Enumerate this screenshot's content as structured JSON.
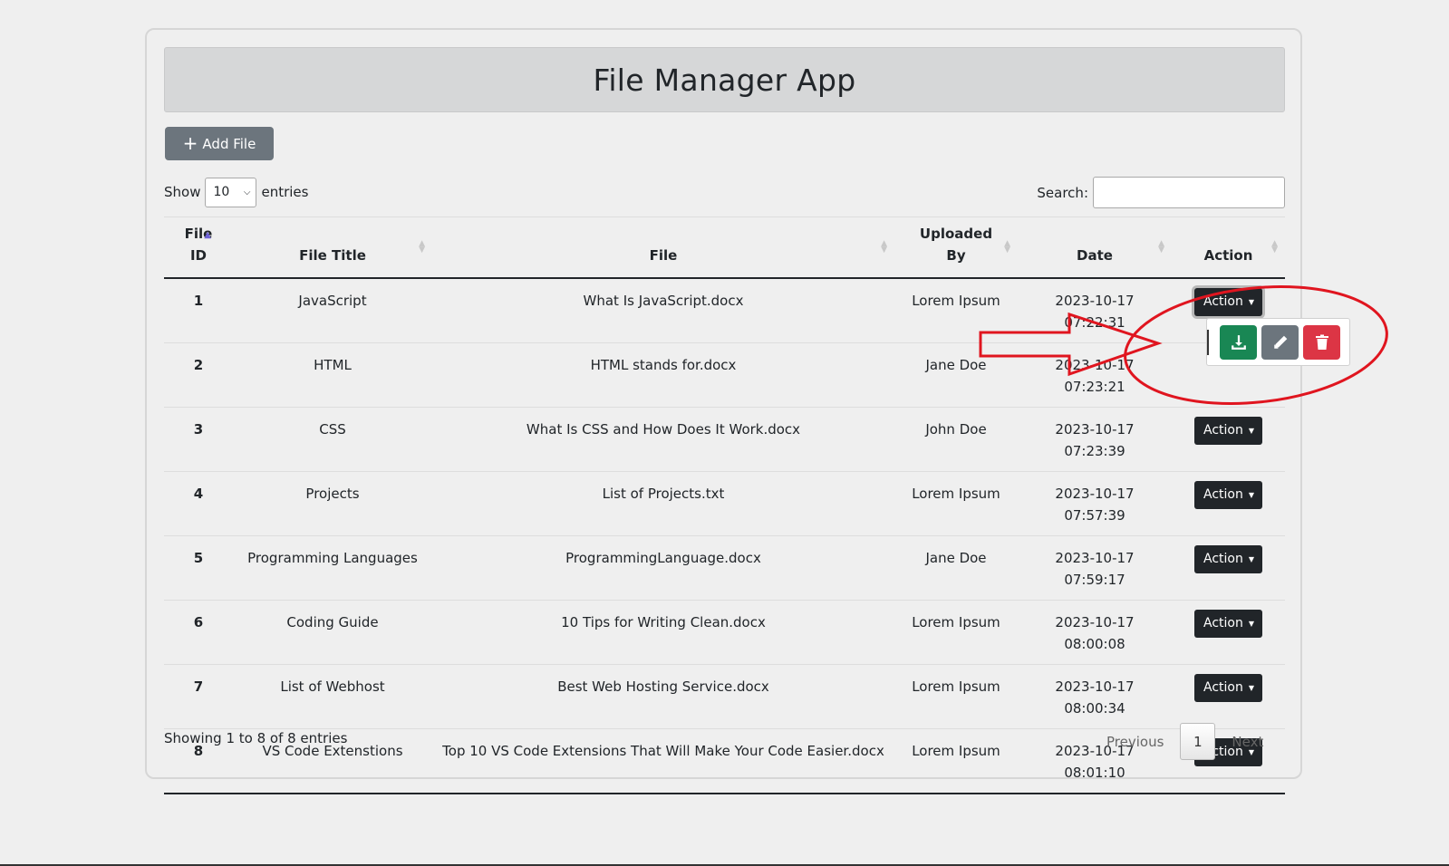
{
  "app": {
    "title": "File Manager App"
  },
  "toolbar": {
    "add_label": "Add File"
  },
  "length_menu": {
    "show": "Show",
    "value": "10",
    "entries": "entries"
  },
  "search": {
    "label": "Search:",
    "value": ""
  },
  "table": {
    "headers": {
      "id_line1": "File",
      "id_line2": "ID",
      "title": "File Title",
      "file": "File",
      "uploaded_line1": "Uploaded",
      "uploaded_line2": "By",
      "date": "Date",
      "action": "Action"
    },
    "sorted_column": "File ID",
    "sort_direction": "ascending",
    "rows": [
      {
        "id": "1",
        "title": "JavaScript",
        "file": "What Is JavaScript.docx",
        "by": "Lorem Ipsum",
        "date": "2023-10-17 07:22:31",
        "action": "Action"
      },
      {
        "id": "2",
        "title": "HTML",
        "file": "HTML stands for.docx",
        "by": "Jane Doe",
        "date": "2023-10-17 07:23:21",
        "action": ""
      },
      {
        "id": "3",
        "title": "CSS",
        "file": "What Is CSS and How Does It Work.docx",
        "by": "John Doe",
        "date": "2023-10-17 07:23:39",
        "action": "Action"
      },
      {
        "id": "4",
        "title": "Projects",
        "file": "List of Projects.txt",
        "by": "Lorem Ipsum",
        "date": "2023-10-17 07:57:39",
        "action": "Action"
      },
      {
        "id": "5",
        "title": "Programming Languages",
        "file": "ProgrammingLanguage.docx",
        "by": "Jane Doe",
        "date": "2023-10-17 07:59:17",
        "action": "Action"
      },
      {
        "id": "6",
        "title": "Coding Guide",
        "file": "10 Tips for Writing Clean.docx",
        "by": "Lorem Ipsum",
        "date": "2023-10-17 08:00:08",
        "action": "Action"
      },
      {
        "id": "7",
        "title": "List of Webhost",
        "file": "Best Web Hosting Service.docx",
        "by": "Lorem Ipsum",
        "date": "2023-10-17 08:00:34",
        "action": "Action"
      },
      {
        "id": "8",
        "title": "VS Code Extenstions",
        "file": "Top 10 VS Code Extensions That Will Make Your Code Easier.docx",
        "by": "Lorem Ipsum",
        "date": "2023-10-17 08:01:10",
        "action": "Action"
      }
    ]
  },
  "dropdown": {
    "open_for_row": "1",
    "items": [
      {
        "icon": "download-icon",
        "color": "#198754"
      },
      {
        "icon": "pencil-icon",
        "color": "#6c757d"
      },
      {
        "icon": "trash-icon",
        "color": "#dc3545"
      }
    ]
  },
  "footer": {
    "info": "Showing 1 to 8 of 8 entries",
    "previous": "Previous",
    "current_page": "1",
    "next": "Next"
  },
  "annotation": {
    "color": "#e0151f",
    "shapes": [
      "arrow",
      "ellipse"
    ]
  }
}
